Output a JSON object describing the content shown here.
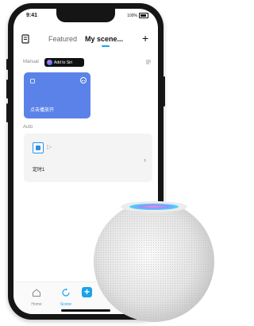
{
  "status_bar": {
    "time": "9:41",
    "battery_text": "100%"
  },
  "header": {
    "tab_featured": "Featured",
    "tab_my_scene": "My scene...",
    "add_icon": "plus-icon"
  },
  "manual": {
    "label": "Manual",
    "siri_badge_text": "Add to Siri"
  },
  "scene_card": {
    "name": "点击播放开",
    "color": "#5b82e8"
  },
  "auto": {
    "label": "Auto",
    "item_name": "定时1"
  },
  "tabbar": {
    "home_label": "Home",
    "scene_label": "Scene",
    "add_symbol": "+"
  },
  "colors": {
    "accent": "#1aa3e8",
    "card_blue": "#5b82e8"
  }
}
